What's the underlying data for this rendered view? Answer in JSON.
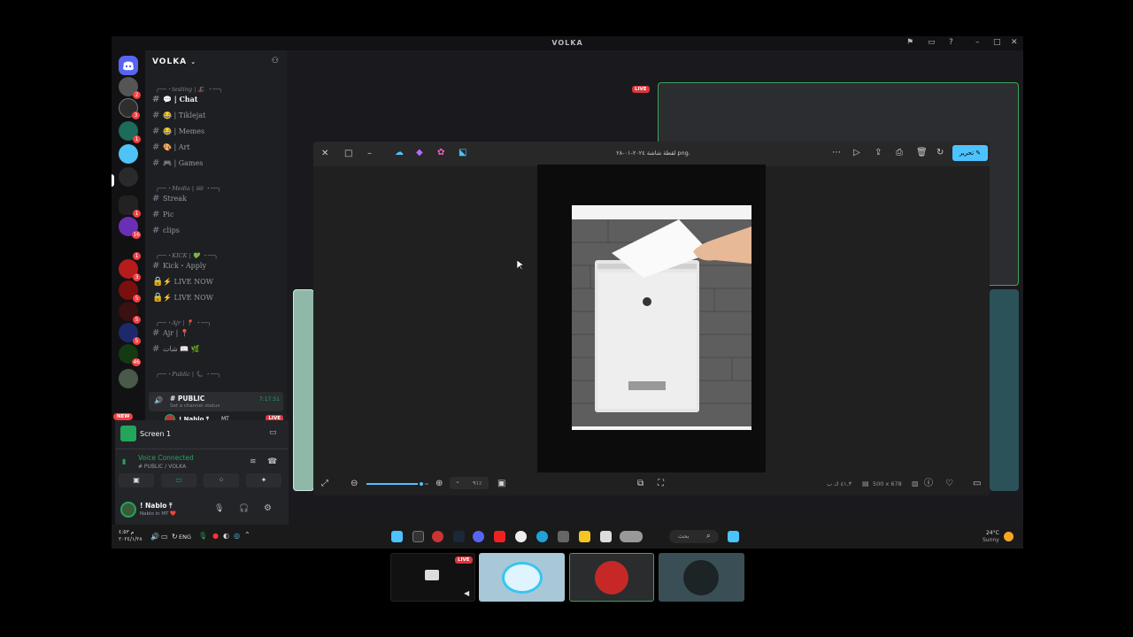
{
  "window": {
    "title": "VOLKA",
    "controls": [
      "⚑",
      "▭",
      "?",
      "–",
      "□",
      "✕"
    ]
  },
  "server": {
    "name": "VOLKA",
    "categories": [
      "╭──・testing | 🎩 ・──╮",
      "╭──・Media | 🎟 ・──╮",
      "╭──・KICK | 💚 ・──╮",
      "╭──・Ajr | 📍 ・──╮",
      "╭──・Public | 📞 ・──╮"
    ],
    "channels": [
      {
        "name": "💬 | Chat",
        "active": true,
        "icon": "hash"
      },
      {
        "name": "😂 | Tiklejat",
        "icon": "hash"
      },
      {
        "name": "😂 | Memes",
        "icon": "hash"
      },
      {
        "name": "🎨 | Art",
        "icon": "hash"
      },
      {
        "name": "🎮 | Games",
        "icon": "hash"
      },
      {
        "name": "Streak",
        "icon": "hash"
      },
      {
        "name": "Pic",
        "icon": "hash"
      },
      {
        "name": "clips",
        "icon": "hash"
      },
      {
        "name": "Kick・Apply",
        "icon": "hash"
      },
      {
        "name": "⚡ LIVE NOW",
        "icon": "lock"
      },
      {
        "name": "⚡ LIVE NOW",
        "icon": "lock"
      },
      {
        "name": "Ajr | 📍",
        "icon": "hash"
      },
      {
        "name": "شات 📖 🌿",
        "icon": "hash"
      }
    ],
    "voice_channel": {
      "name": "# PUBLIC",
      "status": "Set a channel status",
      "time": "7:17:51"
    },
    "voice_user": {
      "name": "! Nablo ⤒",
      "tag": "MT",
      "live": "LIVE"
    },
    "new_badge": "NEW"
  },
  "panel": {
    "screen_label": "Screen 1",
    "voice_connected": "Voice Connected",
    "voice_channel": "# PUBLIC / VOLKA",
    "username": "! Nablo ⤒",
    "user_status": "Nablo in MT ❤️"
  },
  "stream": {
    "live_label": "LIVE"
  },
  "viewer": {
    "filename": "لقطة شاشة ٢٠٢٤-٠١-٢٨ png.",
    "edit_label": "تحرير",
    "zoom": "٩١٪",
    "dimensions": "500 x 678",
    "filesize": "٤١.٣ ك ب",
    "zoom_level": 0.88
  },
  "taskbar": {
    "date": "٢٠٢٤/١/٢٨",
    "time": "م ٤:٥٣",
    "lang": "ENG",
    "search": "بحث",
    "weather_temp": "24°C",
    "weather_desc": "Sunny"
  },
  "thumbnails": [
    {
      "label": "LIVE"
    }
  ],
  "colors": {
    "accent": "#4cc2ff",
    "live": "#da373c",
    "green": "#23a55a",
    "tile_border": "#3ba55d"
  }
}
